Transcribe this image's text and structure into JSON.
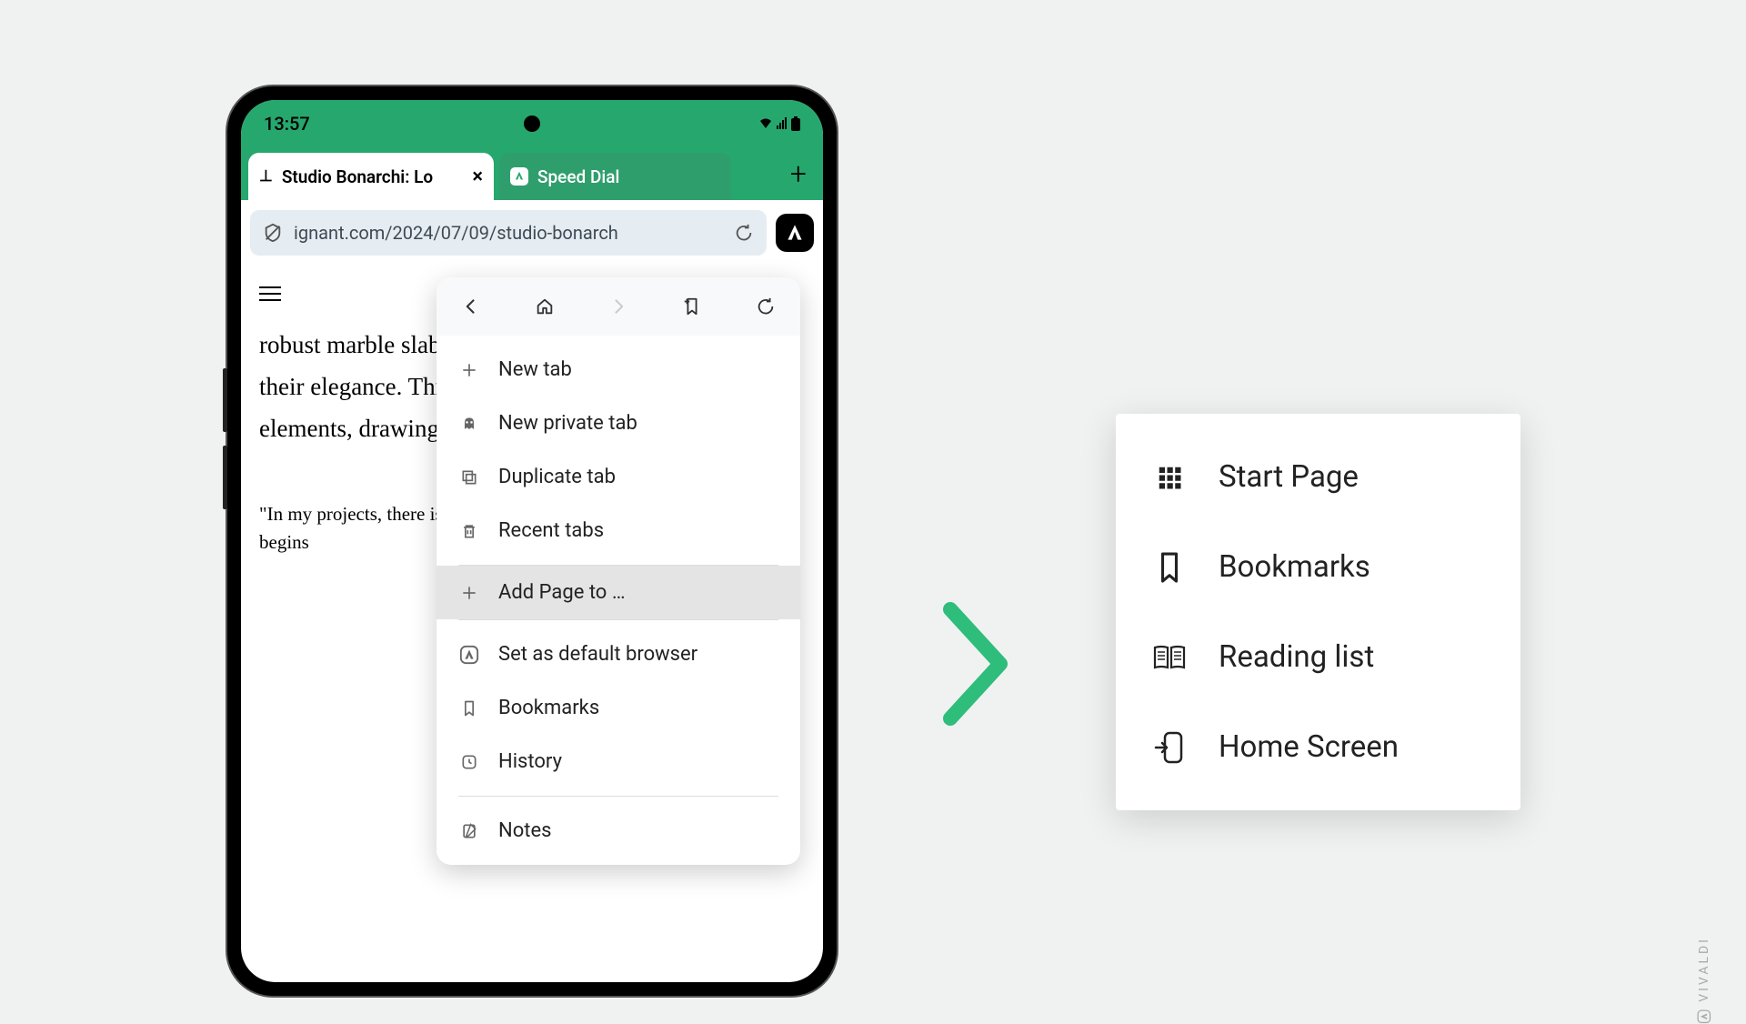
{
  "status": {
    "time": "13:57"
  },
  "tabs": {
    "active_title": "Studio Bonarchi: Lo",
    "inactive_title": "Speed Dial"
  },
  "address": {
    "url": "ignant.com/2024/07/09/studio-bonarch"
  },
  "page": {
    "body_text": "robust marble slabs, between local heritage, modernity, their elegance. Throughout accentuating minimal dark elements, drawing the eye to the room's natural light.",
    "quote_text": "\"In my projects, there is It is a precious gift which everything always begins"
  },
  "menu": {
    "new_tab": "New tab",
    "new_private_tab": "New private tab",
    "duplicate_tab": "Duplicate tab",
    "recent_tabs": "Recent tabs",
    "add_page_to": "Add Page to …",
    "set_default": "Set as default browser",
    "bookmarks": "Bookmarks",
    "history": "History",
    "notes": "Notes"
  },
  "submenu": {
    "start_page": "Start Page",
    "bookmarks": "Bookmarks",
    "reading_list": "Reading list",
    "home_screen": "Home Screen"
  },
  "watermark": "VIVALDI",
  "colors": {
    "accent": "#26a76e"
  }
}
